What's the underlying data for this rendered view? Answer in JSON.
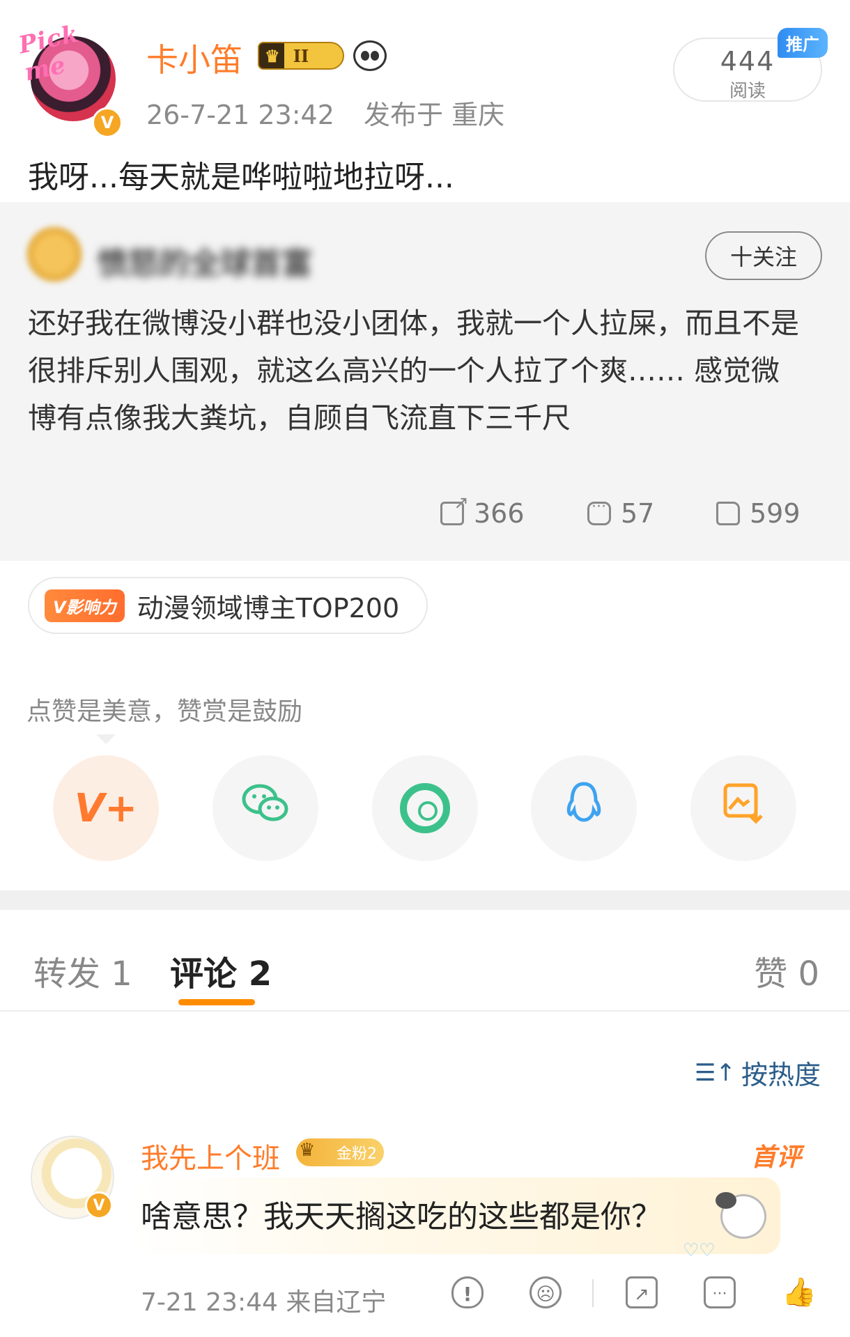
{
  "post": {
    "author_name": "卡小笛",
    "avatar_deco_text": "Pick me",
    "level_badge": "II",
    "timestamp": "26-7-21 23:42",
    "location": "发布于 重庆",
    "read_count": "444",
    "read_label": "阅读",
    "promo_label": "推广",
    "text": "我呀...每天就是哗啦啦地拉呀..."
  },
  "quoted": {
    "author_name": "愤怒的全球首富",
    "follow_label": "十关注",
    "text": "还好我在微博没小群也没小团体，我就一个人拉屎，而且不是很排斥别人围观，就这么高兴的一个人拉了个爽…… 感觉微博有点像我大粪坑，自顾自飞流直下三千尺",
    "shares": "366",
    "comments": "57",
    "likes": "599"
  },
  "influence": {
    "badge": "V影响力",
    "text": "动漫领域博主TOP200"
  },
  "reward": {
    "hint": "点赞是美意，赞赏是鼓励",
    "share_targets": [
      "reward-icon",
      "wechat-icon",
      "moments-icon",
      "qq-icon",
      "save-image-icon"
    ]
  },
  "tabs": {
    "forward": "转发 1",
    "comments": "评论 2",
    "likes": "赞 0"
  },
  "sort": {
    "label": "按热度"
  },
  "comment": {
    "author_name": "我先上个班",
    "fan_badge": "金粉2",
    "first_tag": "首评",
    "text": "啥意思？我天天搁这吃的这些都是你？",
    "meta": "7-21 23:44 来自辽宁"
  },
  "colors": {
    "accent_orange": "#ff7c2a",
    "tab_underline": "#ff8c00",
    "verified_badge": "#f5a623",
    "wechat_green": "#3cc18a",
    "qq_blue": "#3ea3f0",
    "promo_blue": "#2f8cf0"
  }
}
